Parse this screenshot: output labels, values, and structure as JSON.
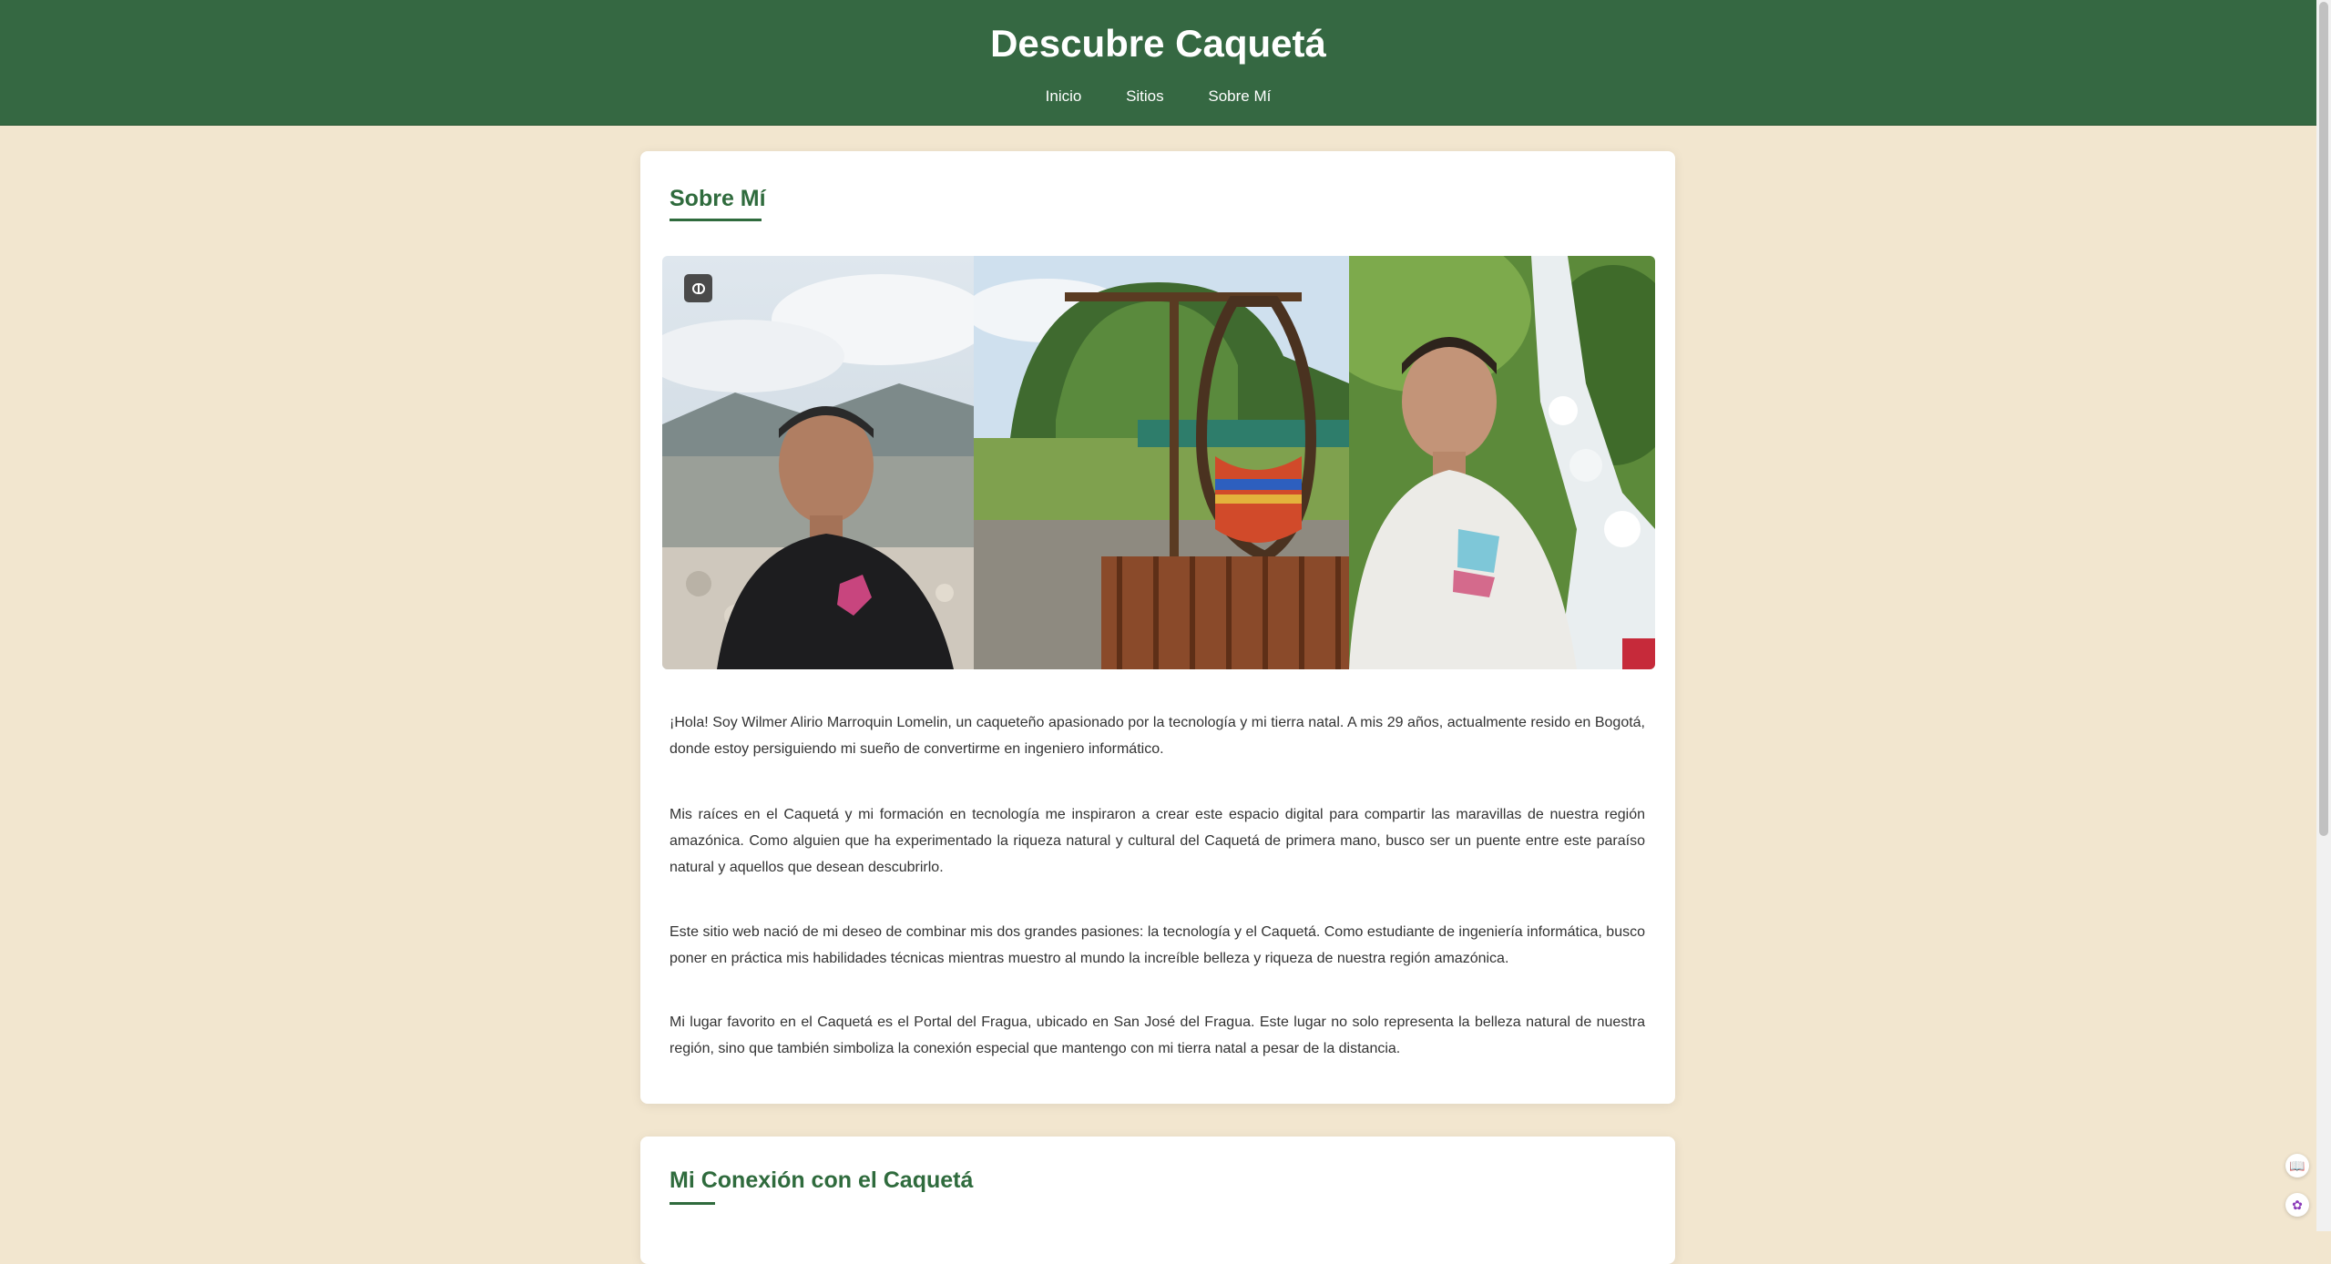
{
  "header": {
    "title": "Descubre Caquetá",
    "nav": [
      "Inicio",
      "Sitios",
      "Sobre Mí"
    ]
  },
  "about": {
    "heading": "Sobre Mí",
    "paragraphs": [
      "¡Hola! Soy Wilmer Alirio Marroquin Lomelin, un caqueteño apasionado por la tecnología y mi tierra natal. A mis 29 años, actualmente resido en Bogotá, donde estoy persiguiendo mi sueño de convertirme en ingeniero informático.",
      "Mis raíces en el Caquetá y mi formación en tecnología me inspiraron a crear este espacio digital para compartir las maravillas de nuestra región amazónica. Como alguien que ha experimentado la riqueza natural y cultural del Caquetá de primera mano, busco ser un puente entre este paraíso natural y aquellos que desean descubrirlo.",
      "Este sitio web nació de mi deseo de combinar mis dos grandes pasiones: la tecnología y el Caquetá. Como estudiante de ingeniería informática, busco poner en práctica mis habilidades técnicas mientras muestro al mundo la increíble belleza y riqueza de nuestra región amazónica.",
      "Mi lugar favorito en el Caquetá es el Portal del Fragua, ubicado en San José del Fragua. Este lugar no solo representa la belleza natural de nuestra región, sino que también simboliza la conexión especial que mantengo con mi tierra natal a pesar de la distancia."
    ]
  },
  "connection": {
    "heading": "Mi Conexión con el Caquetá"
  },
  "widgets": {
    "book_icon": "book-icon",
    "brain_icon": "brain-icon"
  },
  "colors": {
    "header_bg": "#356842",
    "page_bg": "#f2e6cf",
    "accent": "#2f6b3d"
  }
}
